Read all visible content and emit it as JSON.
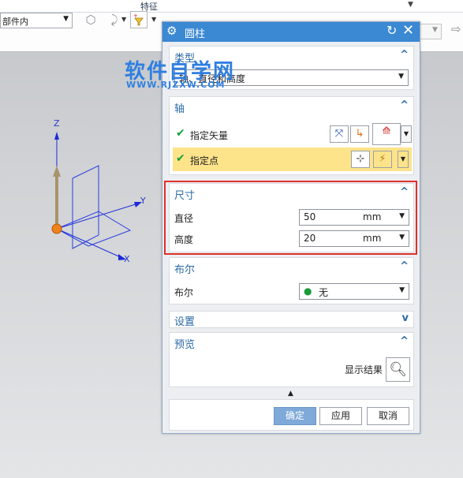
{
  "ribbon": {
    "title": "特征"
  },
  "toolbar": {
    "scope_value": "部件内"
  },
  "watermark": {
    "main": "软件自学网",
    "sub": "WWW.RJZXW.COM"
  },
  "axes": {
    "x_label": "X",
    "y_label": "Y",
    "z_label": "Z"
  },
  "dialog": {
    "title": "圆柱",
    "type_section": {
      "label": "类型",
      "value": "轴、直径和高度"
    },
    "axis_section": {
      "label": "轴",
      "specify_vector": "指定矢量",
      "specify_point": "指定点"
    },
    "dimensions": {
      "label": "尺寸",
      "diameter_label": "直径",
      "diameter_value": "50",
      "diameter_unit": "mm",
      "height_label": "高度",
      "height_value": "20",
      "height_unit": "mm"
    },
    "boolean_section": {
      "label": "布尔",
      "row_label": "布尔",
      "value": "无"
    },
    "settings_section": {
      "label": "设置"
    },
    "preview_section": {
      "label": "预览",
      "show_result": "显示结果"
    },
    "buttons": {
      "ok": "确定",
      "apply": "应用",
      "cancel": "取消"
    }
  },
  "colors": {
    "title_bar": "#3b88d3",
    "highlight": "#e0302c",
    "accent_text": "#2b6aa6",
    "watermark": "#2f7fe0"
  }
}
